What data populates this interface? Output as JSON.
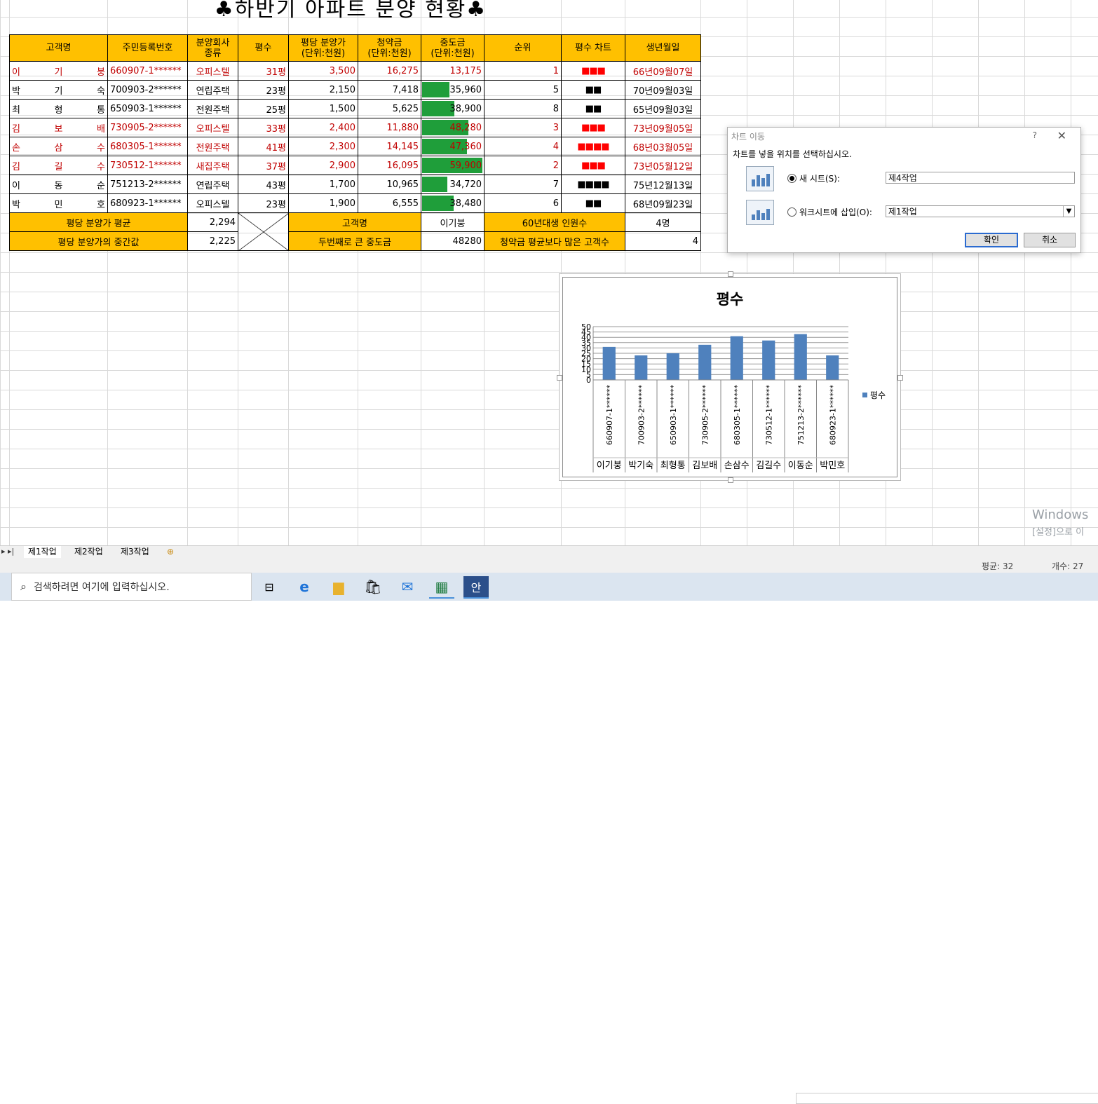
{
  "title": "♣하반기 아파트 분양 현황♣",
  "headers": [
    "고객명",
    "주민등록번호",
    "분양회사\n종류",
    "평수",
    "평당 분양가\n(단위:천원)",
    "청약금\n(단위:천원)",
    "중도금\n(단위:천원)",
    "순위",
    "평수 차트",
    "생년월일"
  ],
  "rows": [
    {
      "n1": "이",
      "n2": "기",
      "n3": "붕",
      "id": "660907-1******",
      "type": "오피스텔",
      "size": "31평",
      "price": "3,500",
      "sub": "16,275",
      "mid": "13,175",
      "mid_pct": 0,
      "rank": "1",
      "chart": "■■■",
      "chart_color": "#ff0000",
      "birth": "66년09월07일",
      "red": true
    },
    {
      "n1": "박",
      "n2": "기",
      "n3": "숙",
      "id": "700903-2******",
      "type": "연립주택",
      "size": "23평",
      "price": "2,150",
      "sub": "7,418",
      "mid": "35,960",
      "mid_pct": 0.45,
      "rank": "5",
      "chart": "■■",
      "chart_color": "#000000",
      "birth": "70년09월03일",
      "red": false
    },
    {
      "n1": "최",
      "n2": "형",
      "n3": "통",
      "id": "650903-1******",
      "type": "전원주택",
      "size": "25평",
      "price": "1,500",
      "sub": "5,625",
      "mid": "38,900",
      "mid_pct": 0.53,
      "rank": "8",
      "chart": "■■",
      "chart_color": "#000000",
      "birth": "65년09월03일",
      "red": false
    },
    {
      "n1": "김",
      "n2": "보",
      "n3": "배",
      "id": "730905-2******",
      "type": "오피스텔",
      "size": "33평",
      "price": "2,400",
      "sub": "11,880",
      "mid": "48,280",
      "mid_pct": 0.77,
      "rank": "3",
      "chart": "■■■",
      "chart_color": "#ff0000",
      "birth": "73년09월05일",
      "red": true
    },
    {
      "n1": "손",
      "n2": "삼",
      "n3": "수",
      "id": "680305-1******",
      "type": "전원주택",
      "size": "41평",
      "price": "2,300",
      "sub": "14,145",
      "mid": "47,360",
      "mid_pct": 0.74,
      "rank": "4",
      "chart": "■■■■",
      "chart_color": "#ff0000",
      "birth": "68년03월05일",
      "red": true
    },
    {
      "n1": "김",
      "n2": "길",
      "n3": "수",
      "id": "730512-1******",
      "type": "새집주택",
      "size": "37평",
      "price": "2,900",
      "sub": "16,095",
      "mid": "59,900",
      "mid_pct": 1.0,
      "rank": "2",
      "chart": "■■■",
      "chart_color": "#ff0000",
      "birth": "73년05월12일",
      "red": true
    },
    {
      "n1": "이",
      "n2": "동",
      "n3": "순",
      "id": "751213-2******",
      "type": "연립주택",
      "size": "43평",
      "price": "1,700",
      "sub": "10,965",
      "mid": "34,720",
      "mid_pct": 0.42,
      "rank": "7",
      "chart": "■■■■",
      "chart_color": "#000000",
      "birth": "75년12월13일",
      "red": false
    },
    {
      "n1": "박",
      "n2": "민",
      "n3": "호",
      "id": "680923-1******",
      "type": "오피스텔",
      "size": "23평",
      "price": "1,900",
      "sub": "6,555",
      "mid": "38,480",
      "mid_pct": 0.52,
      "rank": "6",
      "chart": "■■",
      "chart_color": "#000000",
      "birth": "68년09월23일",
      "red": false
    }
  ],
  "summary": {
    "avg_label": "평당 분양가 평균",
    "avg_value": "2,294",
    "median_label": "평당 분양가의 중간값",
    "median_value": "2,225",
    "cust_label": "고객명",
    "cust_value": "이기붕",
    "second_label": "두번째로 큰 중도금",
    "second_value": "48280",
    "sixties_label": "60년대생 인원수",
    "sixties_value": "4명",
    "above_label": "청약금 평균보다 많은 고객수",
    "above_value": "4"
  },
  "dialog": {
    "title": "차트 이동",
    "help": "?",
    "close": "✕",
    "message": "차트를 넣을 위치를 선택하십시오.",
    "new_sheet_label": "새 시트(S):",
    "new_sheet_value": "제4작업",
    "object_label": "워크시트에 삽입(O):",
    "object_value": "제1작업",
    "ok": "확인",
    "cancel": "취소"
  },
  "chart_data": {
    "type": "bar",
    "title": "평수",
    "categories": [
      [
        "660907-1******",
        "이기붕"
      ],
      [
        "700903-2******",
        "박기숙"
      ],
      [
        "650903-1******",
        "최형통"
      ],
      [
        "730905-2******",
        "김보배"
      ],
      [
        "680305-1******",
        "손삼수"
      ],
      [
        "730512-1******",
        "김길수"
      ],
      [
        "751213-2******",
        "이동순"
      ],
      [
        "680923-1******",
        "박민호"
      ]
    ],
    "series": [
      {
        "name": "평수",
        "values": [
          31,
          23,
          25,
          33,
          41,
          37,
          43,
          23
        ],
        "color": "#4f81bd"
      }
    ],
    "ylim": [
      0,
      50
    ],
    "yticks": [
      "0",
      "5",
      "10",
      "15",
      "20",
      "25",
      "30",
      "35",
      "40",
      "45",
      "50"
    ],
    "legend": "right",
    "grid": true
  },
  "sheet_tabs": [
    "제1작업",
    "제2작업",
    "제3작업"
  ],
  "status": {
    "average": "평균: 32",
    "count": "개수: 27"
  },
  "taskbar": {
    "search_placeholder": "검색하려면 여기에 입력하십시오."
  },
  "watermark": {
    "line1": "Windows",
    "line2": "[설정]으로 이"
  }
}
